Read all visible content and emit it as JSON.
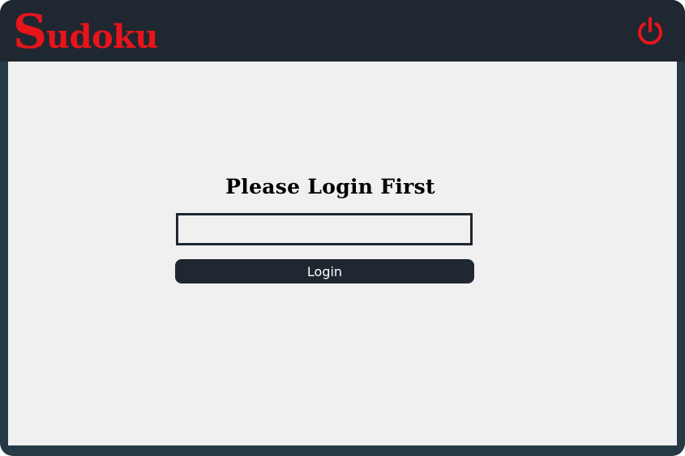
{
  "header": {
    "logo_first_letter": "S",
    "logo_rest": "udoku",
    "power_icon": "power-icon"
  },
  "login": {
    "title": "Please Login First",
    "input_value": "",
    "button_label": "Login"
  },
  "colors": {
    "header_bg": "#1f2730",
    "frame": "#263a45",
    "content_bg": "#f0f0f0",
    "brand_red": "#e8141b",
    "button_bg": "#1f2730"
  }
}
